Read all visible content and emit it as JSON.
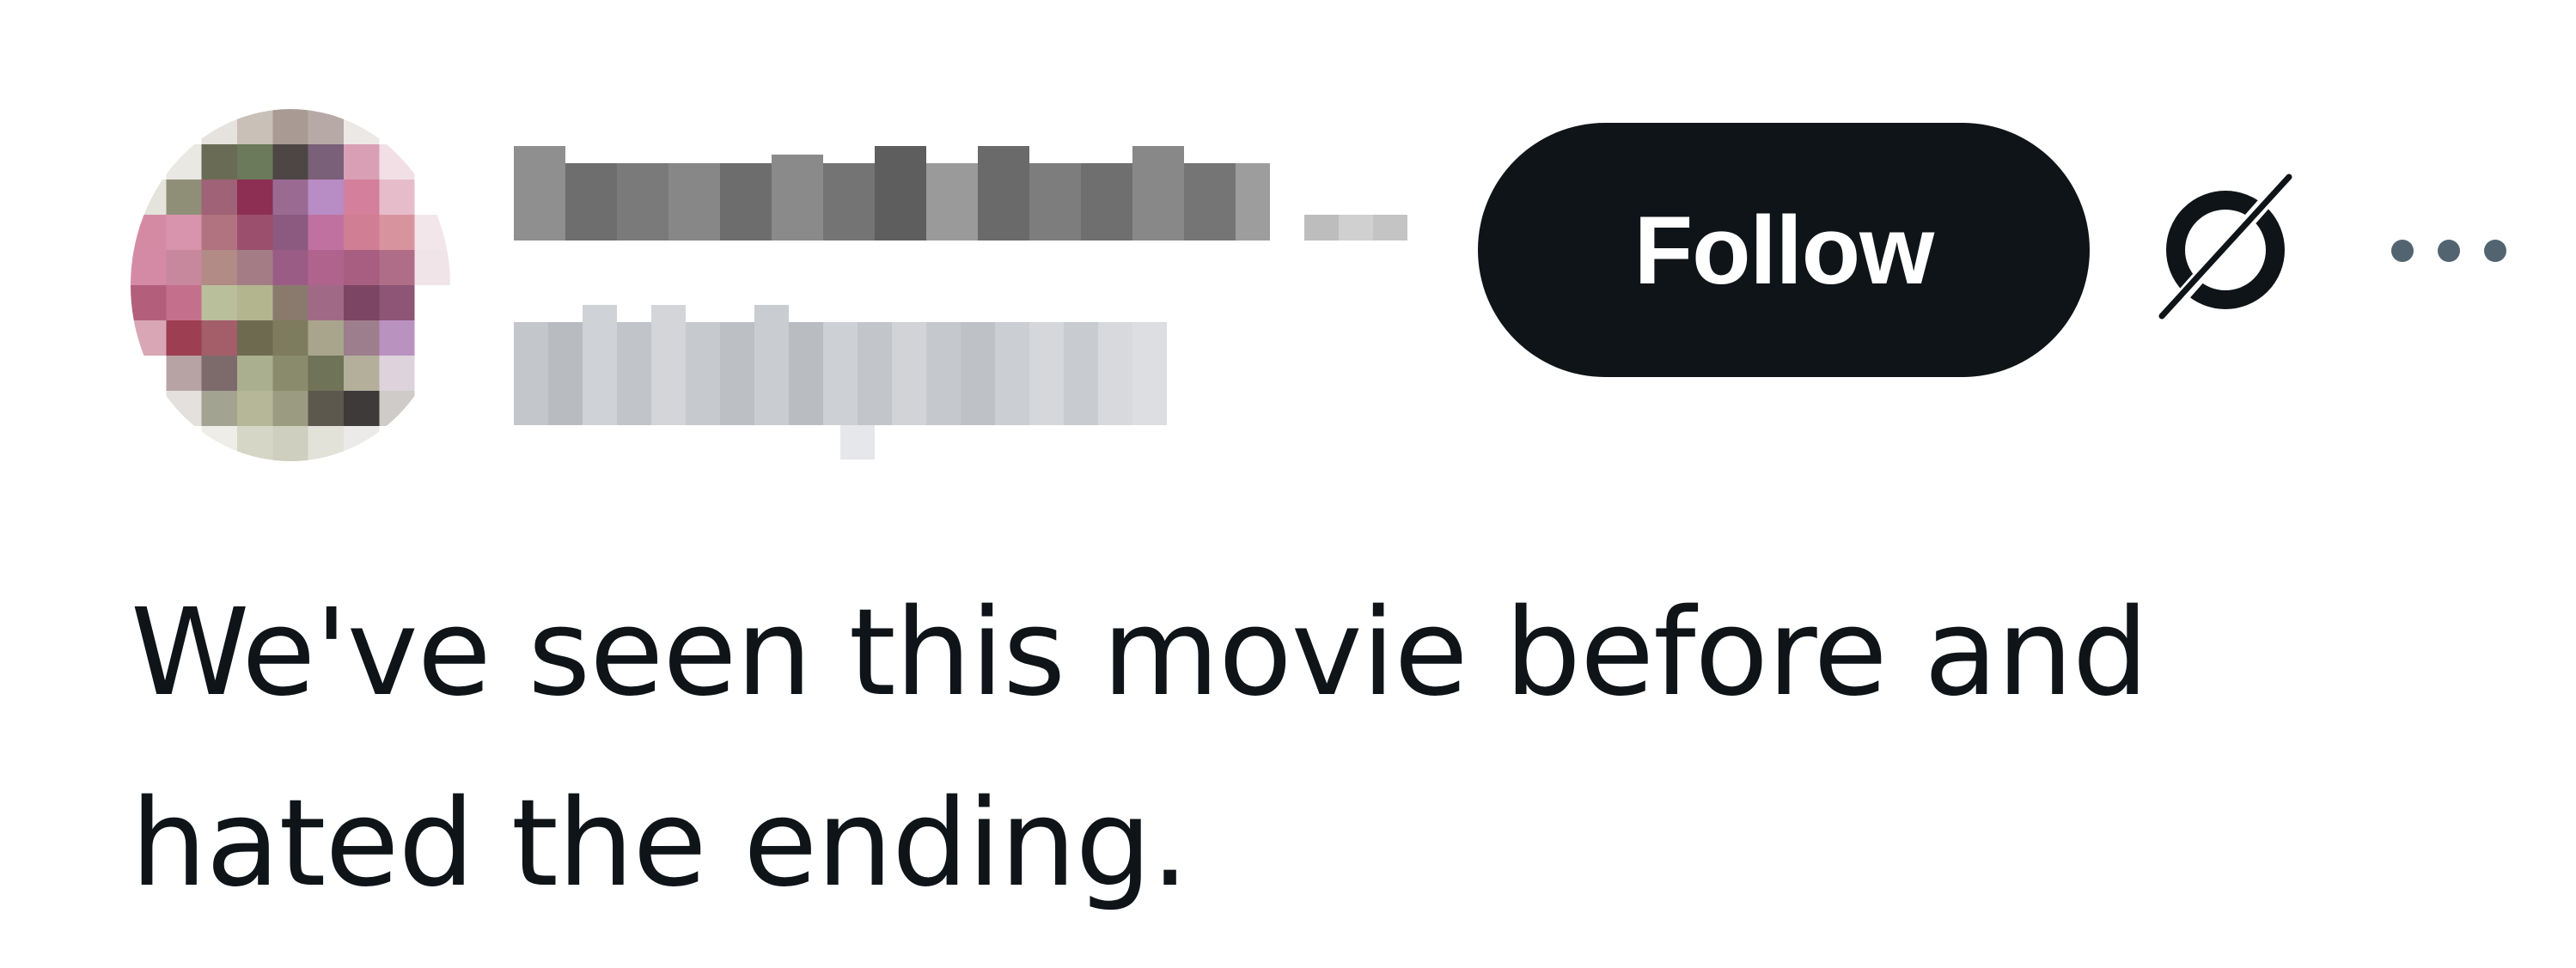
{
  "author": {
    "display_name": "",
    "handle": "",
    "avatar_icon": "pixelated-avatar-icon"
  },
  "actions": {
    "follow_label": "Follow",
    "grok_icon": "slashed-circle-icon",
    "more_icon": "more-horizontal-icon"
  },
  "tweet": {
    "text": "We've seen this movie before and\nhated the ending."
  },
  "colors": {
    "text": "#0f1419",
    "button_bg": "#0f1419",
    "button_text": "#ffffff",
    "background": "#ffffff"
  }
}
